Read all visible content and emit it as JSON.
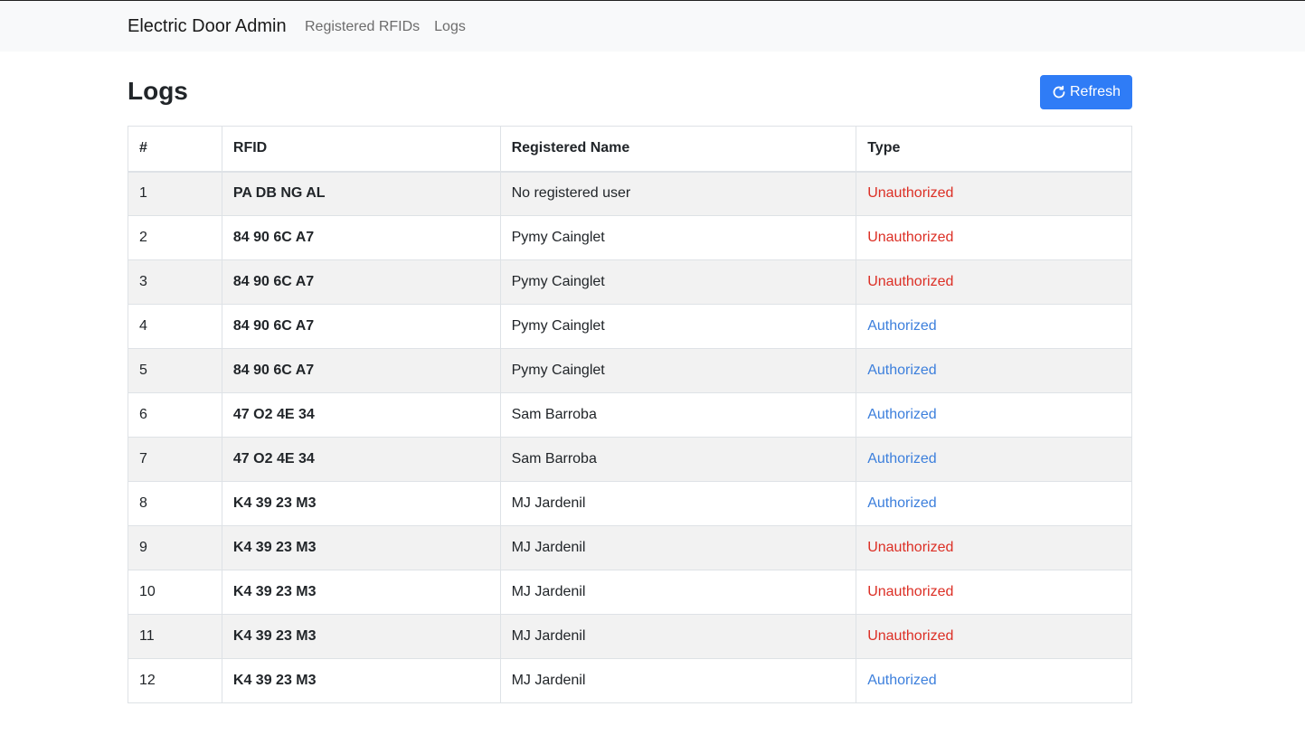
{
  "navbar": {
    "brand": "Electric Door Admin",
    "links": [
      "Registered RFIDs",
      "Logs"
    ]
  },
  "page": {
    "title": "Logs",
    "refresh_label": "Refresh",
    "refresh_icon": "refresh-icon"
  },
  "colors": {
    "primary": "#2f7cf6",
    "unauthorized": "#dc2f25",
    "authorized": "#3c7fdc"
  },
  "table": {
    "headers": [
      "#",
      "RFID",
      "Registered Name",
      "Type"
    ],
    "rows": [
      {
        "num": "1",
        "rfid": "PA DB NG AL",
        "name": "No registered user",
        "type": "Unauthorized"
      },
      {
        "num": "2",
        "rfid": "84 90 6C A7",
        "name": "Pymy Cainglet",
        "type": "Unauthorized"
      },
      {
        "num": "3",
        "rfid": "84 90 6C A7",
        "name": "Pymy Cainglet",
        "type": "Unauthorized"
      },
      {
        "num": "4",
        "rfid": "84 90 6C A7",
        "name": "Pymy Cainglet",
        "type": "Authorized"
      },
      {
        "num": "5",
        "rfid": "84 90 6C A7",
        "name": "Pymy Cainglet",
        "type": "Authorized"
      },
      {
        "num": "6",
        "rfid": "47 O2 4E 34",
        "name": "Sam Barroba",
        "type": "Authorized"
      },
      {
        "num": "7",
        "rfid": "47 O2 4E 34",
        "name": "Sam Barroba",
        "type": "Authorized"
      },
      {
        "num": "8",
        "rfid": "K4 39 23 M3",
        "name": "MJ Jardenil",
        "type": "Authorized"
      },
      {
        "num": "9",
        "rfid": "K4 39 23 M3",
        "name": "MJ Jardenil",
        "type": "Unauthorized"
      },
      {
        "num": "10",
        "rfid": "K4 39 23 M3",
        "name": "MJ Jardenil",
        "type": "Unauthorized"
      },
      {
        "num": "11",
        "rfid": "K4 39 23 M3",
        "name": "MJ Jardenil",
        "type": "Unauthorized"
      },
      {
        "num": "12",
        "rfid": "K4 39 23 M3",
        "name": "MJ Jardenil",
        "type": "Authorized"
      }
    ]
  }
}
